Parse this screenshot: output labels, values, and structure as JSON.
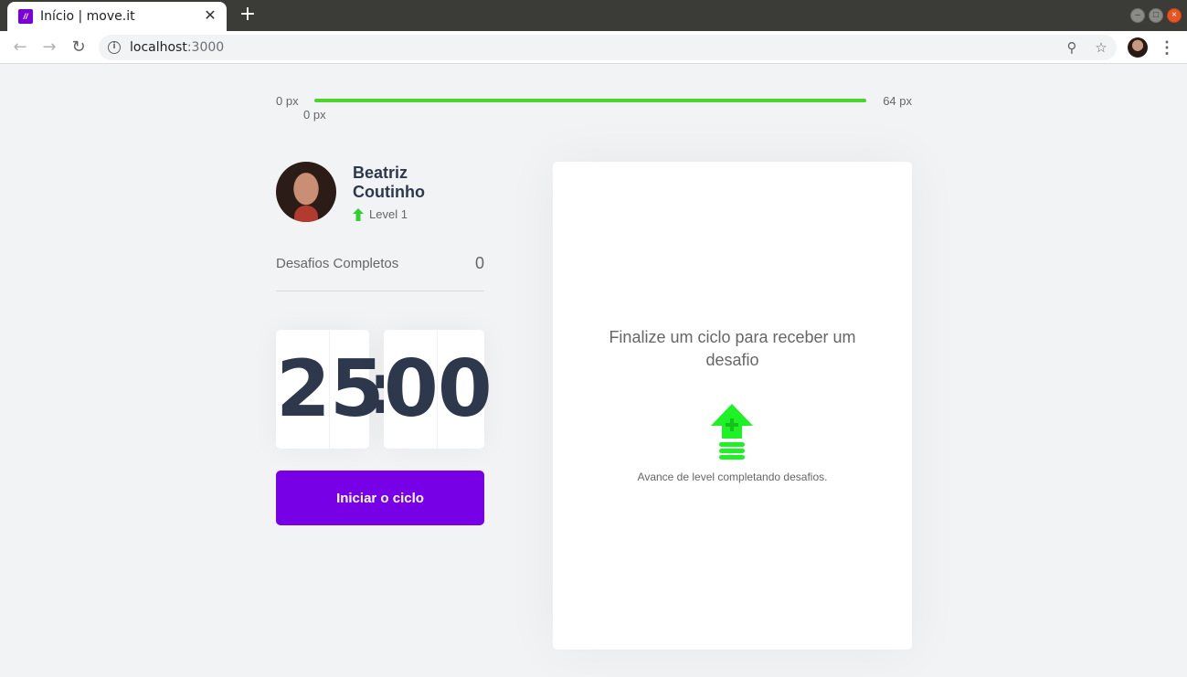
{
  "browser": {
    "tab_title": "Início | move.it",
    "favicon_text": "//",
    "url_host": "localhost",
    "url_port": ":3000",
    "icons": [
      "back-icon",
      "forward-icon",
      "reload-icon",
      "info-icon",
      "zoom-icon",
      "star-icon",
      "profile-avatar",
      "menu-dots-icon",
      "close-icon",
      "plus-icon"
    ]
  },
  "experience": {
    "min_label": "0 px",
    "max_label": "64 px",
    "current_label": "0 px",
    "progress": 1.0,
    "bar_color": "#4cd62b"
  },
  "profile": {
    "name": "Beatriz Coutinho",
    "level_label": "Level 1"
  },
  "completed": {
    "label": "Desafios Completos",
    "value": "0"
  },
  "countdown": {
    "min_left": "2",
    "min_right": "5",
    "colon": ":",
    "sec_left": "0",
    "sec_right": "0"
  },
  "actions": {
    "start_label": "Iniciar o ciclo",
    "start_color": "#7800e6"
  },
  "challenge": {
    "title": "Finalize um ciclo para receber um desafio",
    "subtitle": "Avance de level completando desafios."
  }
}
